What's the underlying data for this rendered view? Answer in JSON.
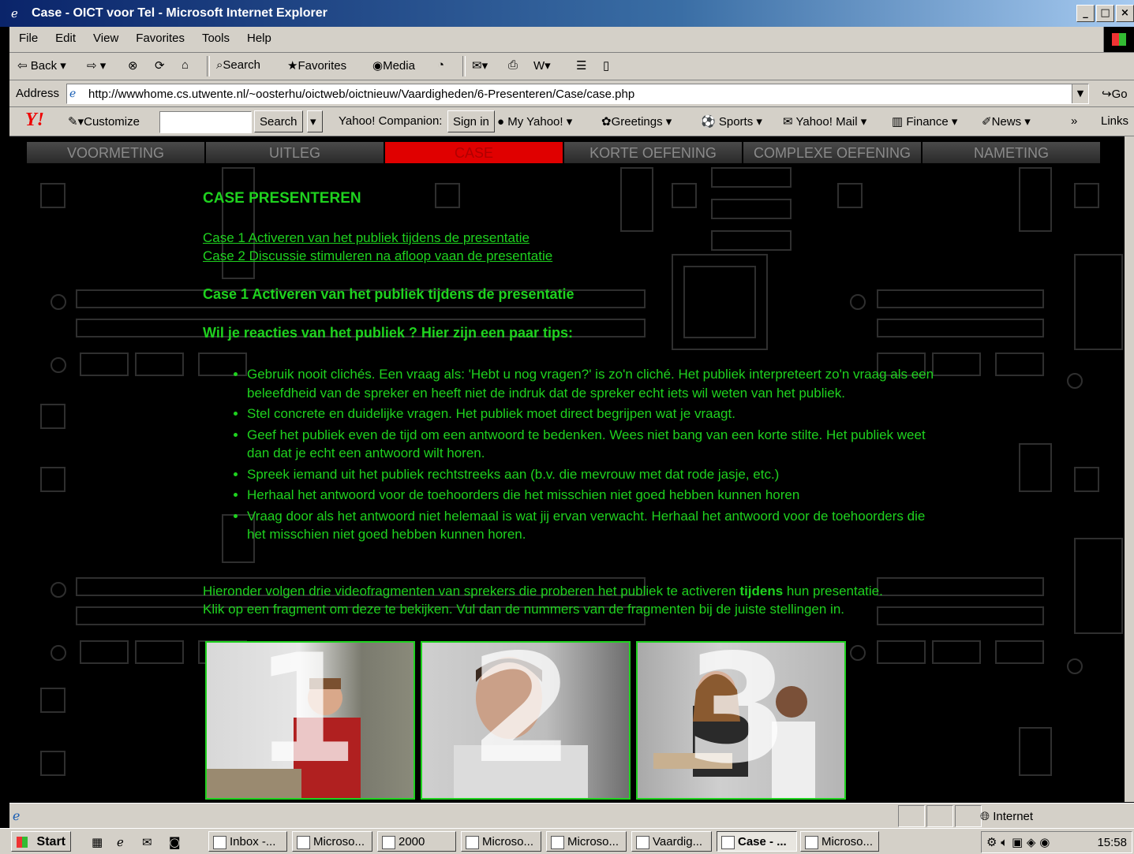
{
  "window": {
    "title": "Case - OICT voor Tel - Microsoft Internet Explorer",
    "buttons": [
      "_",
      "□",
      "×"
    ]
  },
  "menu": [
    "File",
    "Edit",
    "View",
    "Favorites",
    "Tools",
    "Help"
  ],
  "toolbar": {
    "back": "Back",
    "search": "Search",
    "favorites": "Favorites",
    "media": "Media"
  },
  "address": {
    "label": "Address",
    "url": "http://wwwhome.cs.utwente.nl/~oosterhu/oictweb/oictnieuw/Vaardigheden/6-Presenteren/Case/case.php",
    "go": "Go"
  },
  "yahoo": {
    "customize": "Customize",
    "search_button": "Search",
    "companion": "Yahoo! Companion:",
    "sign_in": "Sign in",
    "items": [
      "My Yahoo!",
      "Greetings",
      "Sports",
      "Yahoo! Mail",
      "Finance",
      "News"
    ],
    "more": "»",
    "links": "Links"
  },
  "nav": {
    "tabs": [
      "VOORMETING",
      "UITLEG",
      "CASE",
      "KORTE OEFENING",
      "COMPLEXE OEFENING",
      "NAMETING"
    ],
    "active": "CASE"
  },
  "page": {
    "heading": "CASE PRESENTEREN",
    "links": [
      "Case 1 Activeren van het publiek tijdens de presentatie",
      "Case 2 Discussie stimuleren na afloop vaan de presentatie"
    ],
    "case_title": "Case 1 Activeren van het publiek tijdens de presentatie",
    "tips_title": "Wil je reacties van het publiek ? Hier zijn een paar tips:",
    "tips": [
      "Gebruik nooit clichés. Een vraag als: 'Hebt u nog vragen?' is zo'n cliché. Het publiek interpreteert zo'n vraag als een beleefdheid van de spreker en heeft niet de indruk dat de spreker echt iets wil weten van het publiek.",
      "Stel concrete en duidelijke vragen. Het publiek moet direct begrijpen wat je vraagt.",
      "Geef het publiek even de tijd om een antwoord te bedenken. Wees niet bang van een korte stilte. Het publiek weet dan dat je echt een antwoord wilt horen.",
      "Spreek iemand uit het publiek rechtstreeks aan (b.v. die mevrouw met dat rode jasje, etc.)",
      "Herhaal het antwoord voor de toehoorders die het misschien niet goed hebben kunnen horen",
      "Vraag door als het antwoord niet helemaal is wat jij ervan verwacht. Herhaal het antwoord voor de toehoorders die het misschien niet goed hebben kunnen horen."
    ],
    "para_line1_a": "Hieronder volgen drie videofragmenten van sprekers die proberen het publiek te activeren ",
    "para_line1_bold": "tijdens",
    "para_line1_b": " hun presentatie.",
    "para_line2": "Klik op een fragment om deze te bekijken. Vul dan de nummers van de fragmenten bij de juiste stellingen in.",
    "videos": [
      "1",
      "2",
      "3"
    ]
  },
  "status": {
    "zone": "Internet"
  },
  "taskbar": {
    "start": "Start",
    "tasks": [
      "Inbox -...",
      "Microso...",
      "2000",
      "Microso...",
      "Microso...",
      "Vaardig...",
      "Case - ...",
      "Microso..."
    ],
    "active_task": "Case - ...",
    "clock": "15:58"
  },
  "colors": {
    "accent_green": "#1fd21f",
    "active_tab": "#e00000",
    "title_bar": "#0a246a"
  }
}
